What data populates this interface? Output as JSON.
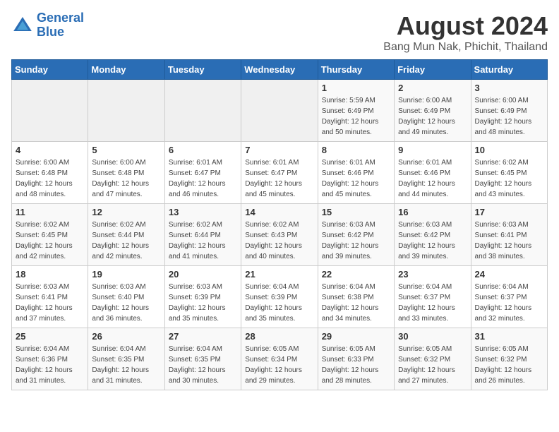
{
  "logo": {
    "line1": "General",
    "line2": "Blue"
  },
  "title": "August 2024",
  "subtitle": "Bang Mun Nak, Phichit, Thailand",
  "headers": [
    "Sunday",
    "Monday",
    "Tuesday",
    "Wednesday",
    "Thursday",
    "Friday",
    "Saturday"
  ],
  "weeks": [
    [
      {
        "day": "",
        "sunrise": "",
        "sunset": "",
        "daylight": ""
      },
      {
        "day": "",
        "sunrise": "",
        "sunset": "",
        "daylight": ""
      },
      {
        "day": "",
        "sunrise": "",
        "sunset": "",
        "daylight": ""
      },
      {
        "day": "",
        "sunrise": "",
        "sunset": "",
        "daylight": ""
      },
      {
        "day": "1",
        "sunrise": "Sunrise: 5:59 AM",
        "sunset": "Sunset: 6:49 PM",
        "daylight": "Daylight: 12 hours and 50 minutes."
      },
      {
        "day": "2",
        "sunrise": "Sunrise: 6:00 AM",
        "sunset": "Sunset: 6:49 PM",
        "daylight": "Daylight: 12 hours and 49 minutes."
      },
      {
        "day": "3",
        "sunrise": "Sunrise: 6:00 AM",
        "sunset": "Sunset: 6:49 PM",
        "daylight": "Daylight: 12 hours and 48 minutes."
      }
    ],
    [
      {
        "day": "4",
        "sunrise": "Sunrise: 6:00 AM",
        "sunset": "Sunset: 6:48 PM",
        "daylight": "Daylight: 12 hours and 48 minutes."
      },
      {
        "day": "5",
        "sunrise": "Sunrise: 6:00 AM",
        "sunset": "Sunset: 6:48 PM",
        "daylight": "Daylight: 12 hours and 47 minutes."
      },
      {
        "day": "6",
        "sunrise": "Sunrise: 6:01 AM",
        "sunset": "Sunset: 6:47 PM",
        "daylight": "Daylight: 12 hours and 46 minutes."
      },
      {
        "day": "7",
        "sunrise": "Sunrise: 6:01 AM",
        "sunset": "Sunset: 6:47 PM",
        "daylight": "Daylight: 12 hours and 45 minutes."
      },
      {
        "day": "8",
        "sunrise": "Sunrise: 6:01 AM",
        "sunset": "Sunset: 6:46 PM",
        "daylight": "Daylight: 12 hours and 45 minutes."
      },
      {
        "day": "9",
        "sunrise": "Sunrise: 6:01 AM",
        "sunset": "Sunset: 6:46 PM",
        "daylight": "Daylight: 12 hours and 44 minutes."
      },
      {
        "day": "10",
        "sunrise": "Sunrise: 6:02 AM",
        "sunset": "Sunset: 6:45 PM",
        "daylight": "Daylight: 12 hours and 43 minutes."
      }
    ],
    [
      {
        "day": "11",
        "sunrise": "Sunrise: 6:02 AM",
        "sunset": "Sunset: 6:45 PM",
        "daylight": "Daylight: 12 hours and 42 minutes."
      },
      {
        "day": "12",
        "sunrise": "Sunrise: 6:02 AM",
        "sunset": "Sunset: 6:44 PM",
        "daylight": "Daylight: 12 hours and 42 minutes."
      },
      {
        "day": "13",
        "sunrise": "Sunrise: 6:02 AM",
        "sunset": "Sunset: 6:44 PM",
        "daylight": "Daylight: 12 hours and 41 minutes."
      },
      {
        "day": "14",
        "sunrise": "Sunrise: 6:02 AM",
        "sunset": "Sunset: 6:43 PM",
        "daylight": "Daylight: 12 hours and 40 minutes."
      },
      {
        "day": "15",
        "sunrise": "Sunrise: 6:03 AM",
        "sunset": "Sunset: 6:42 PM",
        "daylight": "Daylight: 12 hours and 39 minutes."
      },
      {
        "day": "16",
        "sunrise": "Sunrise: 6:03 AM",
        "sunset": "Sunset: 6:42 PM",
        "daylight": "Daylight: 12 hours and 39 minutes."
      },
      {
        "day": "17",
        "sunrise": "Sunrise: 6:03 AM",
        "sunset": "Sunset: 6:41 PM",
        "daylight": "Daylight: 12 hours and 38 minutes."
      }
    ],
    [
      {
        "day": "18",
        "sunrise": "Sunrise: 6:03 AM",
        "sunset": "Sunset: 6:41 PM",
        "daylight": "Daylight: 12 hours and 37 minutes."
      },
      {
        "day": "19",
        "sunrise": "Sunrise: 6:03 AM",
        "sunset": "Sunset: 6:40 PM",
        "daylight": "Daylight: 12 hours and 36 minutes."
      },
      {
        "day": "20",
        "sunrise": "Sunrise: 6:03 AM",
        "sunset": "Sunset: 6:39 PM",
        "daylight": "Daylight: 12 hours and 35 minutes."
      },
      {
        "day": "21",
        "sunrise": "Sunrise: 6:04 AM",
        "sunset": "Sunset: 6:39 PM",
        "daylight": "Daylight: 12 hours and 35 minutes."
      },
      {
        "day": "22",
        "sunrise": "Sunrise: 6:04 AM",
        "sunset": "Sunset: 6:38 PM",
        "daylight": "Daylight: 12 hours and 34 minutes."
      },
      {
        "day": "23",
        "sunrise": "Sunrise: 6:04 AM",
        "sunset": "Sunset: 6:37 PM",
        "daylight": "Daylight: 12 hours and 33 minutes."
      },
      {
        "day": "24",
        "sunrise": "Sunrise: 6:04 AM",
        "sunset": "Sunset: 6:37 PM",
        "daylight": "Daylight: 12 hours and 32 minutes."
      }
    ],
    [
      {
        "day": "25",
        "sunrise": "Sunrise: 6:04 AM",
        "sunset": "Sunset: 6:36 PM",
        "daylight": "Daylight: 12 hours and 31 minutes."
      },
      {
        "day": "26",
        "sunrise": "Sunrise: 6:04 AM",
        "sunset": "Sunset: 6:35 PM",
        "daylight": "Daylight: 12 hours and 31 minutes."
      },
      {
        "day": "27",
        "sunrise": "Sunrise: 6:04 AM",
        "sunset": "Sunset: 6:35 PM",
        "daylight": "Daylight: 12 hours and 30 minutes."
      },
      {
        "day": "28",
        "sunrise": "Sunrise: 6:05 AM",
        "sunset": "Sunset: 6:34 PM",
        "daylight": "Daylight: 12 hours and 29 minutes."
      },
      {
        "day": "29",
        "sunrise": "Sunrise: 6:05 AM",
        "sunset": "Sunset: 6:33 PM",
        "daylight": "Daylight: 12 hours and 28 minutes."
      },
      {
        "day": "30",
        "sunrise": "Sunrise: 6:05 AM",
        "sunset": "Sunset: 6:32 PM",
        "daylight": "Daylight: 12 hours and 27 minutes."
      },
      {
        "day": "31",
        "sunrise": "Sunrise: 6:05 AM",
        "sunset": "Sunset: 6:32 PM",
        "daylight": "Daylight: 12 hours and 26 minutes."
      }
    ]
  ]
}
